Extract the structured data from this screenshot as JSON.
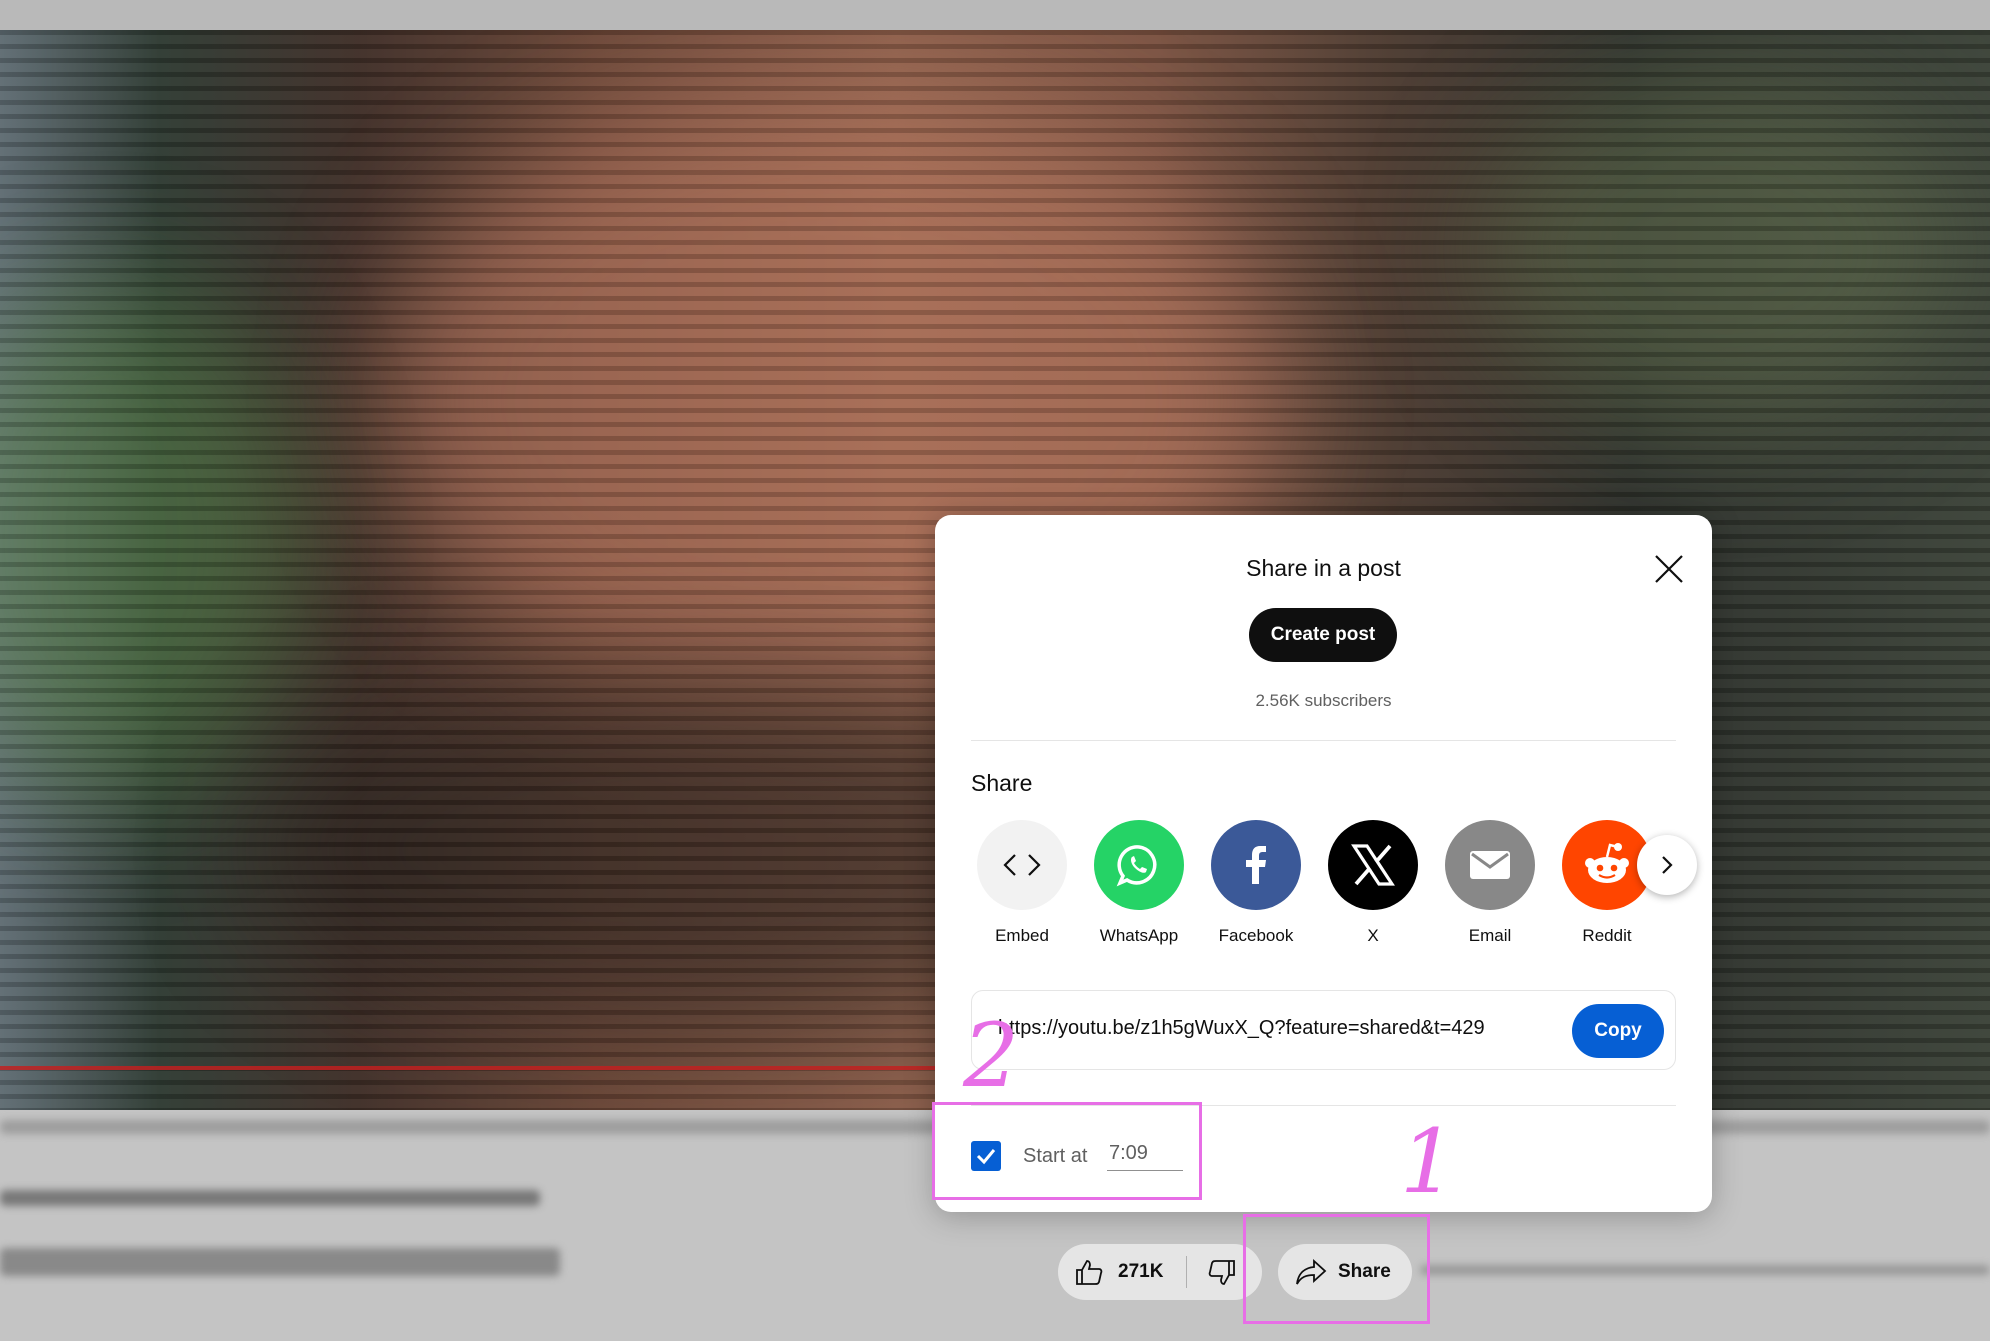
{
  "dialog": {
    "title": "Share in a post",
    "create_post_label": "Create post",
    "subscribers": "2.56K subscribers",
    "share_heading": "Share",
    "share_options": [
      {
        "label": "Embed",
        "icon": "embed-icon",
        "color": "#f2f2f2"
      },
      {
        "label": "WhatsApp",
        "icon": "whatsapp-icon",
        "color": "#25d366"
      },
      {
        "label": "Facebook",
        "icon": "facebook-icon",
        "color": "#3b5998"
      },
      {
        "label": "X",
        "icon": "x-icon",
        "color": "#000000"
      },
      {
        "label": "Email",
        "icon": "email-icon",
        "color": "#888888"
      },
      {
        "label": "Reddit",
        "icon": "reddit-icon",
        "color": "#ff4500"
      }
    ],
    "link": "https://youtu.be/z1h5gWuxX_Q?feature=shared&t=429",
    "copy_label": "Copy",
    "start_at_label": "Start at",
    "start_at_value": "7:09",
    "start_at_checked": true
  },
  "actions": {
    "like_count": "271K",
    "share_label": "Share"
  },
  "annotations": {
    "step1": "1",
    "step2": "2",
    "color": "#e76ee6"
  },
  "colors": {
    "accent": "#065fd4"
  }
}
